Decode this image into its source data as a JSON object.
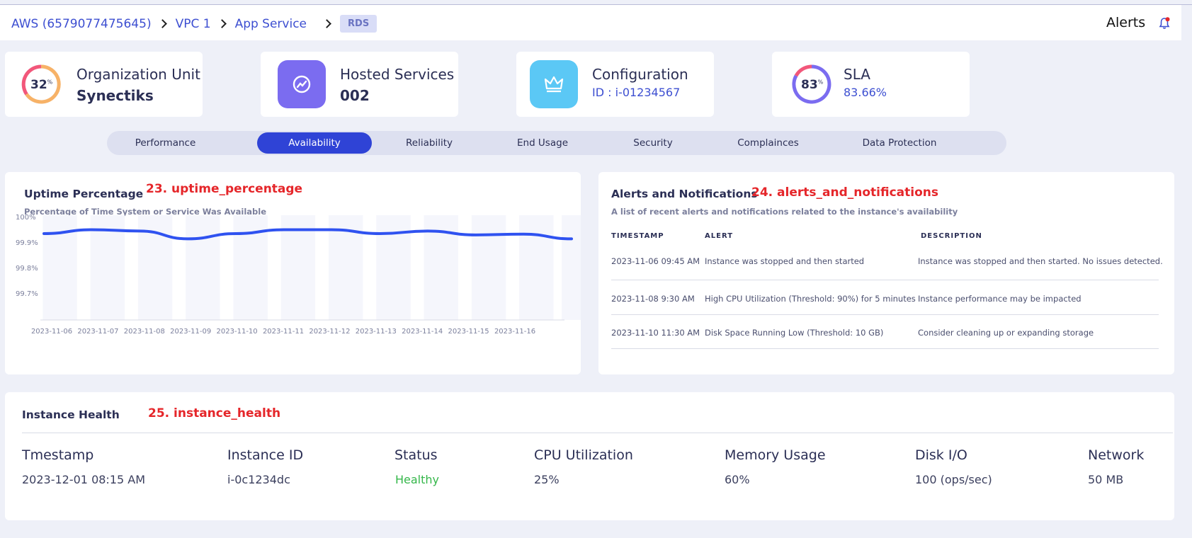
{
  "breadcrumb": {
    "items": [
      "AWS (6579077475645)",
      "VPC 1",
      "App Service"
    ],
    "badge": "RDS"
  },
  "header": {
    "alerts_label": "Alerts",
    "icon": "bell-icon"
  },
  "stats": {
    "org_unit": {
      "ring_value": "32",
      "ring_unit": "%",
      "title": "Organization Unit",
      "value": "Synectiks"
    },
    "hosted": {
      "title": "Hosted Services",
      "value": "002",
      "icon": "chart-up-icon",
      "color": "#7b6cf0"
    },
    "config": {
      "title": "Configuration",
      "value": "ID : i-01234567",
      "icon": "crown-icon",
      "color": "#5bc8f5"
    },
    "sla": {
      "ring_value": "83",
      "ring_unit": "%",
      "title": "SLA",
      "value": "83.66%"
    }
  },
  "tabs": [
    "Performance",
    "Availability",
    "Reliability",
    "End Usage",
    "Security",
    "Complainces",
    "Data Protection"
  ],
  "active_tab": "Availability",
  "uptime": {
    "title": "Uptime Percentage",
    "annotation": "23. uptime_percentage",
    "subtitle": "Percentage of Time System or Service Was Available"
  },
  "chart_data": {
    "type": "line",
    "title": "Uptime Percentage",
    "x": [
      "2023-11-06",
      "2023-11-07",
      "2023-11-08",
      "2023-11-09",
      "2023-11-10",
      "2023-11-11",
      "2023-11-12",
      "2023-11-13",
      "2023-11-14",
      "2023-11-15",
      "2023-11-16"
    ],
    "y_ticks": [
      "100%",
      "99.9%",
      "99.8%",
      "99.7%"
    ],
    "ylim": [
      99.6,
      100
    ],
    "series": [
      {
        "values": [
          99.97,
          99.985,
          99.98,
          99.95,
          99.97,
          99.985,
          99.985,
          99.97,
          99.98,
          99.965,
          99.968,
          99.95
        ],
        "color": "#2f52f0"
      }
    ],
    "grid": false
  },
  "alerts": {
    "title": "Alerts and Notifications",
    "annotation": "24. alerts_and_notifications",
    "subtitle": "A list of recent alerts and notifications related to the instance's availability",
    "columns": [
      "TIMESTAMP",
      "ALERT",
      "DESCRIPTION"
    ],
    "rows": [
      [
        "2023-11-06 09:45 AM",
        "Instance was stopped and then started",
        "Instance was stopped and then started. No issues detected."
      ],
      [
        "2023-11-08 9:30 AM",
        "High CPU Utilization (Threshold: 90%) for 5 minutes",
        "Instance performance may be impacted"
      ],
      [
        "2023-11-10 11:30 AM",
        "Disk Space Running Low (Threshold: 10 GB)",
        "Consider cleaning up or expanding storage"
      ]
    ]
  },
  "health": {
    "title": "Instance Health",
    "annotation": "25. instance_health",
    "columns": [
      "Tmestamp",
      "Instance ID",
      "Status",
      "CPU Utilization",
      "Memory Usage",
      "Disk I/O",
      "Network"
    ],
    "values": [
      "2023-12-01 08:15 AM",
      "i-0c1234dc",
      "Healthy",
      "25%",
      "60%",
      "100 (ops/sec)",
      "50 MB"
    ],
    "status_color": "#35b74a"
  }
}
